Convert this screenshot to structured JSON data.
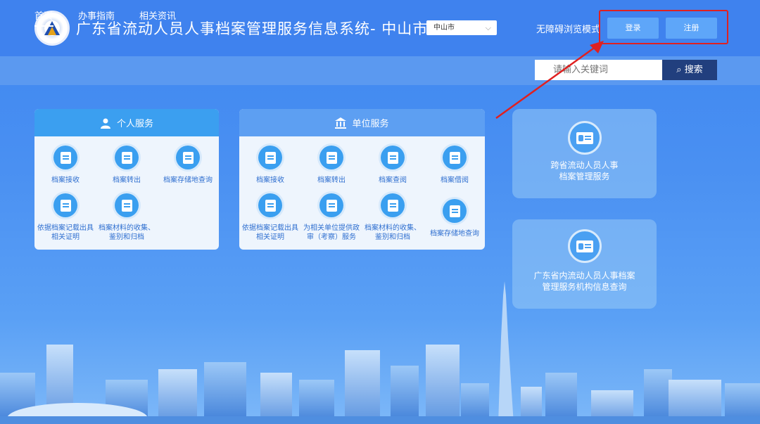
{
  "header": {
    "title": "广东省流动人员人事档案管理服务信息系统- 中山市",
    "city_select": "中山市",
    "access_mode": "无障碍浏览模式",
    "login": "登录",
    "register": "注册"
  },
  "nav": {
    "items": [
      "首页",
      "办事指南",
      "相关资讯"
    ],
    "search_placeholder": "请输入关键词",
    "search_button": "搜索"
  },
  "personal": {
    "title": "个人服务",
    "items": [
      "档案接收",
      "档案转出",
      "档案存储地查询",
      "依据档案记载出具相关证明",
      "档案材料的收集、鉴别和归档"
    ]
  },
  "unit": {
    "title": "单位服务",
    "items": [
      "档案接收",
      "档案转出",
      "档案查阅",
      "档案借阅",
      "依据档案记载出具相关证明",
      "为相关单位提供政审（考察）服务",
      "档案材料的收集、鉴别和归档",
      "档案存储地查询"
    ]
  },
  "cards": {
    "cross_region": "跨省流动人员人事档案管理服务",
    "agency_query": "广东省内流动人员人事档案管理服务机构信息查询"
  },
  "colors": {
    "accent": "#3f82ee",
    "highlight": "#e02020",
    "dark_button": "#213f7e"
  }
}
